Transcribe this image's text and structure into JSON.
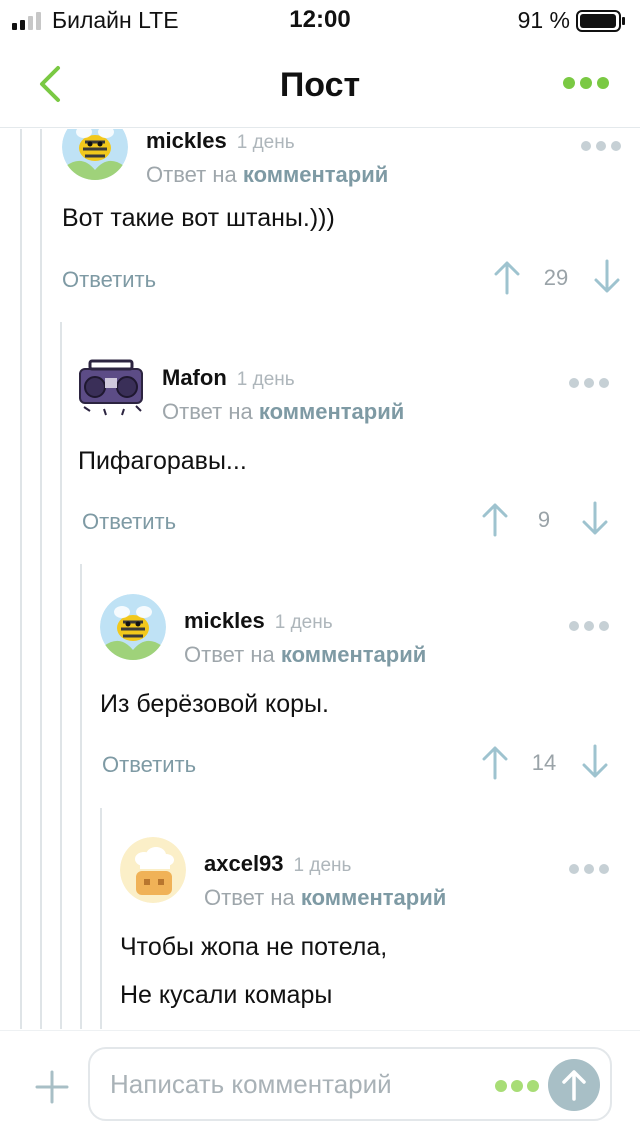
{
  "status_bar": {
    "carrier": "Билайн  LTE",
    "time": "12:00",
    "battery": "91 %"
  },
  "nav": {
    "title": "Пост"
  },
  "colors": {
    "accent_green": "#7ac943",
    "link": "#7e9aa4",
    "muted": "#aeb6bb",
    "divider": "#dfe4e7"
  },
  "comments": [
    {
      "username": "mickles",
      "time": "1 день",
      "reply_prefix": "Ответ на",
      "reply_link": "комментарий",
      "text_lines": [
        "Вот такие вот штаны.)))"
      ],
      "reply_label": "Ответить",
      "score": "29",
      "avatar": "bee-avatar"
    },
    {
      "username": "Mafon",
      "time": "1 день",
      "reply_prefix": "Ответ на",
      "reply_link": "комментарий",
      "text_lines": [
        "Пифагоравы..."
      ],
      "reply_label": "Ответить",
      "score": "9",
      "avatar": "boombox-avatar"
    },
    {
      "username": "mickles",
      "time": "1 день",
      "reply_prefix": "Ответ на",
      "reply_link": "комментарий",
      "text_lines": [
        "Из берёзовой коры."
      ],
      "reply_label": "Ответить",
      "score": "14",
      "avatar": "bee-avatar"
    },
    {
      "username": "axcel93",
      "time": "1 день",
      "reply_prefix": "Ответ на",
      "reply_link": "комментарий",
      "text_lines": [
        "Чтобы жопа не потела,",
        "Не кусали комары"
      ],
      "avatar": "chef-house-avatar"
    }
  ],
  "input": {
    "placeholder": "Написать комментарий"
  }
}
